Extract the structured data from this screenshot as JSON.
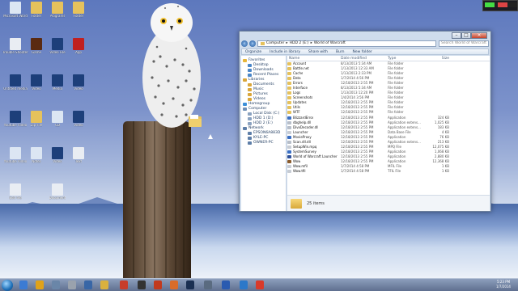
{
  "explorer": {
    "breadcrumb": [
      "Computer",
      "HDD 2 (E:)",
      "World of Warcraft"
    ],
    "search_placeholder": "Search World of Warcraft",
    "commands": [
      "Organize",
      "Include in library",
      "Share with",
      "Burn",
      "New folder"
    ],
    "nav": [
      {
        "label": "Favorites",
        "icon": "star-icon",
        "color": "#e7b63b"
      },
      {
        "label": "Desktop",
        "icon": "desktop-icon",
        "color": "#4a86c8"
      },
      {
        "label": "Downloads",
        "icon": "download-icon",
        "color": "#4a86c8"
      },
      {
        "label": "Recent Places",
        "icon": "recent-icon",
        "color": "#4a86c8"
      },
      {
        "label": "",
        "icon": "",
        "color": ""
      },
      {
        "label": "Libraries",
        "icon": "library-icon",
        "color": "#d9a63a"
      },
      {
        "label": "Documents",
        "icon": "documents-icon",
        "color": "#d9a63a"
      },
      {
        "label": "Music",
        "icon": "music-icon",
        "color": "#d9a63a"
      },
      {
        "label": "Pictures",
        "icon": "pictures-icon",
        "color": "#d9a63a"
      },
      {
        "label": "Videos",
        "icon": "videos-icon",
        "color": "#d9a63a"
      },
      {
        "label": "",
        "icon": "",
        "color": ""
      },
      {
        "label": "Homegroup",
        "icon": "homegroup-icon",
        "color": "#3b8fd9"
      },
      {
        "label": "",
        "icon": "",
        "color": ""
      },
      {
        "label": "Computer",
        "icon": "computer-icon",
        "color": "#6f8fb6"
      },
      {
        "label": "Local Disk (C:)",
        "icon": "drive-icon",
        "color": "#8aa2c0"
      },
      {
        "label": "HDD 1 (D:)",
        "icon": "drive-icon",
        "color": "#8aa2c0"
      },
      {
        "label": "HDD 2 (E:)",
        "icon": "drive-icon",
        "color": "#8aa2c0"
      },
      {
        "label": "",
        "icon": "",
        "color": ""
      },
      {
        "label": "Network",
        "icon": "network-icon",
        "color": "#5d7ea8"
      },
      {
        "label": "EPSON6A883D",
        "icon": "device-icon",
        "color": "#5d7ea8"
      },
      {
        "label": "KYLE-PC",
        "icon": "device-icon",
        "color": "#5d7ea8"
      },
      {
        "label": "OWNER-PC",
        "icon": "device-icon",
        "color": "#5d7ea8"
      }
    ],
    "columns": [
      "Name",
      "Date modified",
      "Type",
      "Size"
    ],
    "files": [
      {
        "name": "Account",
        "date": "8/13/2013 5:34 AM",
        "type": "File folder",
        "size": "",
        "color": "#e6c25c"
      },
      {
        "name": "Battle.net",
        "date": "1/13/2013 12:33 AM",
        "type": "File folder",
        "size": "",
        "color": "#e6c25c"
      },
      {
        "name": "Cache",
        "date": "1/13/2013 2:33 PM",
        "type": "File folder",
        "size": "",
        "color": "#e6c25c"
      },
      {
        "name": "Data",
        "date": "1/7/2014 4:56 PM",
        "type": "File folder",
        "size": "",
        "color": "#e6c25c"
      },
      {
        "name": "Errors",
        "date": "12/18/2013 2:55 PM",
        "type": "File folder",
        "size": "",
        "color": "#e6c25c"
      },
      {
        "name": "Interface",
        "date": "8/13/2013 5:34 AM",
        "type": "File folder",
        "size": "",
        "color": "#e6c25c"
      },
      {
        "name": "Logs",
        "date": "1/13/2013 12:20 PM",
        "type": "File folder",
        "size": "",
        "color": "#e6c25c"
      },
      {
        "name": "Screenshots",
        "date": "1/4/2014 3:56 PM",
        "type": "File folder",
        "size": "",
        "color": "#e6c25c"
      },
      {
        "name": "Updates",
        "date": "12/18/2013 2:55 PM",
        "type": "File folder",
        "size": "",
        "color": "#e6c25c"
      },
      {
        "name": "Utils",
        "date": "12/18/2013 2:55 PM",
        "type": "File folder",
        "size": "",
        "color": "#e6c25c"
      },
      {
        "name": "WTF",
        "date": "12/18/2013 2:55 PM",
        "type": "File folder",
        "size": "",
        "color": "#e6c25c"
      },
      {
        "name": "BlizzardError",
        "date": "12/18/2013 2:55 PM",
        "type": "Application",
        "size": "324 KB",
        "color": "#3a6fc4"
      },
      {
        "name": "dbghelp.dll",
        "date": "12/18/2013 2:55 PM",
        "type": "Application extens...",
        "size": "1,025 KB",
        "color": "#b7bec9"
      },
      {
        "name": "DivxDecoder.dll",
        "date": "12/18/2013 2:55 PM",
        "type": "Application extens...",
        "size": "183 KB",
        "color": "#b7bec9"
      },
      {
        "name": "Launcher",
        "date": "12/18/2013 2:55 PM",
        "type": "Data Base File",
        "size": "4 KB",
        "color": "#c7ccd4"
      },
      {
        "name": "MovieProxy",
        "date": "12/18/2013 2:55 PM",
        "type": "Application",
        "size": "76 KB",
        "color": "#3a6fc4"
      },
      {
        "name": "Scan.dll.dll",
        "date": "12/18/2013 2:55 PM",
        "type": "Application extens...",
        "size": "213 KB",
        "color": "#b7bec9"
      },
      {
        "name": "SetupWin.mpq",
        "date": "12/18/2013 2:55 PM",
        "type": "MPQ File",
        "size": "12,075 KB",
        "color": "#c7ccd4"
      },
      {
        "name": "SystemSurvey",
        "date": "12/18/2013 2:55 PM",
        "type": "Application",
        "size": "1,068 KB",
        "color": "#3a6fc4"
      },
      {
        "name": "World of Warcraft Launcher",
        "date": "12/18/2013 2:55 PM",
        "type": "Application",
        "size": "2,880 KB",
        "color": "#2d4f9a"
      },
      {
        "name": "Wow",
        "date": "12/18/2013 2:55 PM",
        "type": "Application",
        "size": "12,368 KB",
        "color": "#8a5b2c"
      },
      {
        "name": "Wow.mfil",
        "date": "1/7/2014 4:58 PM",
        "type": "MFIL File",
        "size": "1 KB",
        "color": "#c7ccd4"
      },
      {
        "name": "Wow.tfil",
        "date": "1/7/2014 4:58 PM",
        "type": "TFIL File",
        "size": "1 KB",
        "color": "#c7ccd4"
      }
    ],
    "item_count": "25 items"
  },
  "desktop": {
    "icons": [
      {
        "label": "Microsoft Word",
        "color": "#dce6f3"
      },
      {
        "label": "Trouble Shooter",
        "color": "#e9edf3"
      },
      {
        "label": "Untitled media",
        "color": "#1d3f7a"
      },
      {
        "label": "Youtube Video",
        "color": "#1d3f7a"
      },
      {
        "label": "Youtube Video",
        "color": "#dce6f3"
      },
      {
        "label": "Edit file",
        "color": "#e9edf3"
      },
      {
        "label": "",
        "color": ""
      },
      {
        "label": "Folder",
        "color": "#e6c25c"
      },
      {
        "label": "Game",
        "color": "#5a2a10"
      },
      {
        "label": "Video",
        "color": "#1d3f7a"
      },
      {
        "label": "Zip File",
        "color": "#e6c25c"
      },
      {
        "label": "Notes",
        "color": "#dce6f3"
      },
      {
        "label": "",
        "color": ""
      },
      {
        "label": "",
        "color": ""
      },
      {
        "label": "Programs",
        "color": "#e6c25c"
      },
      {
        "label": "Video File",
        "color": "#1d3f7a"
      },
      {
        "label": "Media",
        "color": "#1d3f7a"
      },
      {
        "label": "CD",
        "color": "#dce6f3"
      },
      {
        "label": "Video",
        "color": "#1d3f7a"
      },
      {
        "label": "Document",
        "color": "#e9edf3"
      },
      {
        "label": "",
        "color": ""
      },
      {
        "label": "Folder",
        "color": "#e6c25c"
      },
      {
        "label": "App",
        "color": "#c02020"
      },
      {
        "label": "Video",
        "color": "#1d3f7a"
      },
      {
        "label": "Video",
        "color": "#1d3f7a"
      },
      {
        "label": "Text",
        "color": "#e9edf3"
      },
      {
        "label": "",
        "color": ""
      },
      {
        "label": "",
        "color": ""
      }
    ]
  },
  "taskbar": {
    "time": "5:23 PM",
    "date": "1/7/2014"
  }
}
